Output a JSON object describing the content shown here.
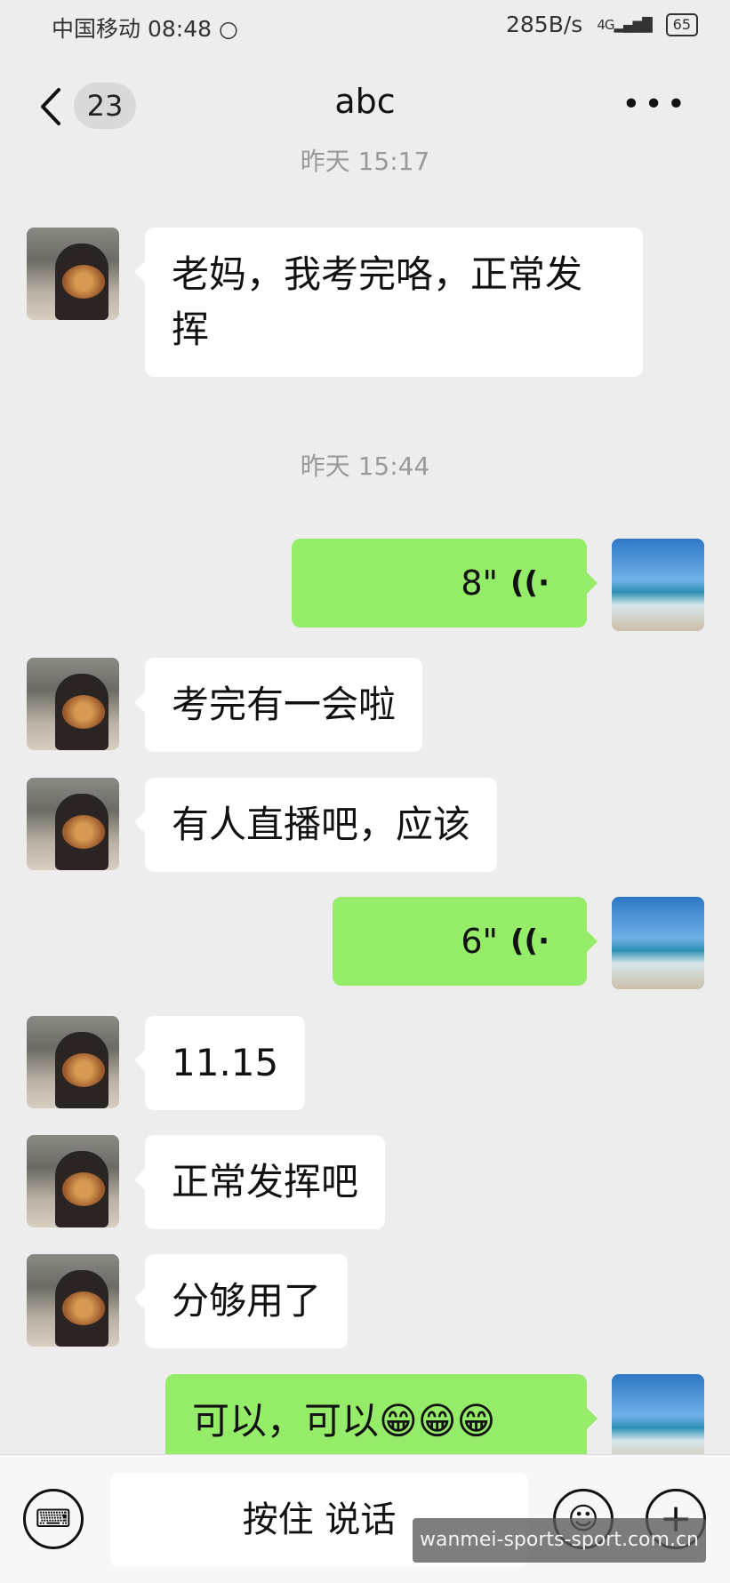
{
  "status_bar": {
    "carrier": "中国移动",
    "time": "08:48",
    "speed": "285B/s",
    "network": "4G",
    "battery": "65"
  },
  "header": {
    "back_count": "23",
    "title": "abc",
    "more_icon": "more-icon"
  },
  "messages": [
    {
      "type": "timestamp",
      "text": "昨天 15:17"
    },
    {
      "type": "text",
      "side": "left",
      "text": "老妈，我考完咯，正常发挥"
    },
    {
      "type": "timestamp",
      "text": "昨天 15:44"
    },
    {
      "type": "voice",
      "side": "right",
      "duration": "8\""
    },
    {
      "type": "text",
      "side": "left",
      "text": "考完有一会啦"
    },
    {
      "type": "text",
      "side": "left",
      "text": "有人直播吧，应该"
    },
    {
      "type": "voice",
      "side": "right",
      "duration": "6\""
    },
    {
      "type": "text",
      "side": "left",
      "text": "11.15"
    },
    {
      "type": "text",
      "side": "left",
      "text": "正常发挥吧"
    },
    {
      "type": "text",
      "side": "left",
      "text": "分够用了"
    },
    {
      "type": "text",
      "side": "right",
      "text": "可以，可以😁😁😁"
    }
  ],
  "input_bar": {
    "hold_to_talk": "按住 说话",
    "keyboard_icon": "keyboard-icon",
    "emoji_icon": "emoji-icon",
    "plus_icon": "plus-icon"
  },
  "watermark": "wanmei-sports-sport.com.cn",
  "colors": {
    "background": "#ededed",
    "outgoing_bubble": "#95ec69",
    "incoming_bubble": "#ffffff"
  }
}
